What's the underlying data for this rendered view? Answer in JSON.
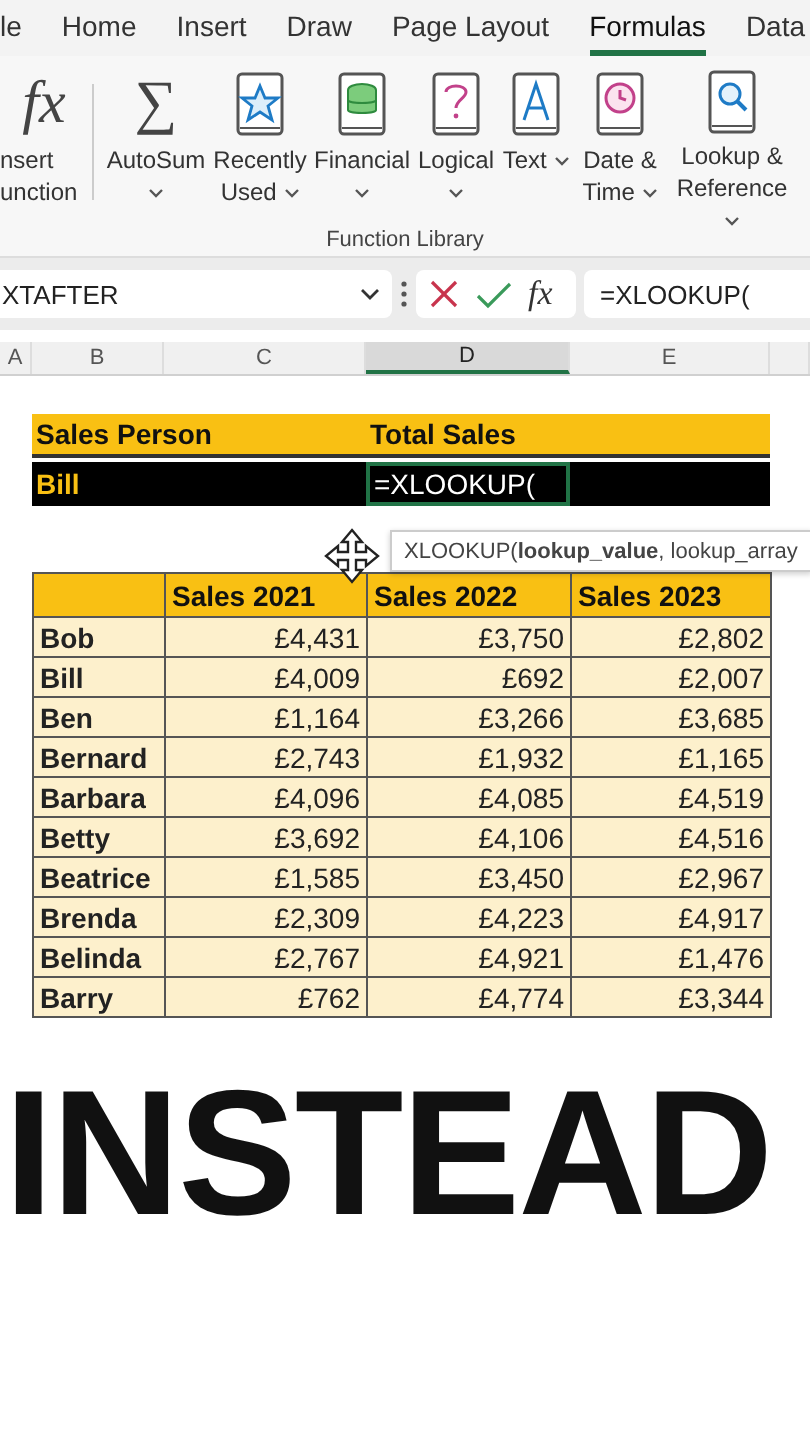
{
  "ribbon_tabs": [
    {
      "label": "le",
      "selected": false
    },
    {
      "label": "Home",
      "selected": false
    },
    {
      "label": "Insert",
      "selected": false
    },
    {
      "label": "Draw",
      "selected": false
    },
    {
      "label": "Page Layout",
      "selected": false
    },
    {
      "label": "Formulas",
      "selected": true
    },
    {
      "label": "Data",
      "selected": false
    }
  ],
  "ribbon": {
    "buttons": [
      {
        "glyph": "fx",
        "label": "nsert\nunction",
        "dropdown": false
      },
      {
        "glyph": "∑",
        "label": "AutoSum",
        "dropdown": true
      },
      {
        "label": "Recently\nUsed",
        "dropdown": true
      },
      {
        "label": "Financial",
        "dropdown": true
      },
      {
        "label": "Logical",
        "dropdown": true
      },
      {
        "label": "Text",
        "dropdown": true
      },
      {
        "label": "Date &\nTime",
        "dropdown": true
      },
      {
        "label": "Lookup &\nReference",
        "dropdown": true
      }
    ],
    "group_label": "Function Library"
  },
  "formula_bar": {
    "name_box": "XTAFTER",
    "fx_button": "fx",
    "formula": "=XLOOKUP("
  },
  "column_headers": [
    {
      "label": "A",
      "selected": false
    },
    {
      "label": "B",
      "selected": false
    },
    {
      "label": "C",
      "selected": false
    },
    {
      "label": "D",
      "selected": true
    },
    {
      "label": "E",
      "selected": false
    }
  ],
  "lookup": {
    "headers": [
      "Sales Person",
      "Total Sales"
    ],
    "name": "Bill",
    "formula": "=XLOOKUP("
  },
  "tooltip": "XLOOKUP(**lookup_value**, lookup_array",
  "sales_table": {
    "columns": [
      "Sales 2021",
      "Sales 2022",
      "Sales 2023"
    ],
    "rows": [
      {
        "name": "Bob",
        "values": [
          "£4,431",
          "£3,750",
          "£2,802"
        ]
      },
      {
        "name": "Bill",
        "values": [
          "£4,009",
          "£692",
          "£2,007"
        ]
      },
      {
        "name": "Ben",
        "values": [
          "£1,164",
          "£3,266",
          "£3,685"
        ]
      },
      {
        "name": "Bernard",
        "values": [
          "£2,743",
          "£1,932",
          "£1,165"
        ]
      },
      {
        "name": "Barbara",
        "values": [
          "£4,096",
          "£4,085",
          "£4,519"
        ]
      },
      {
        "name": "Betty",
        "values": [
          "£3,692",
          "£4,106",
          "£4,516"
        ]
      },
      {
        "name": "Beatrice",
        "values": [
          "£1,585",
          "£3,450",
          "£2,967"
        ]
      },
      {
        "name": "Brenda",
        "values": [
          "£2,309",
          "£4,223",
          "£4,917"
        ]
      },
      {
        "name": "Belinda",
        "values": [
          "£2,767",
          "£4,921",
          "£1,476"
        ]
      },
      {
        "name": "Barry",
        "values": [
          "£762",
          "£4,774",
          "£3,344"
        ]
      }
    ]
  },
  "caption": "INSTEAD"
}
